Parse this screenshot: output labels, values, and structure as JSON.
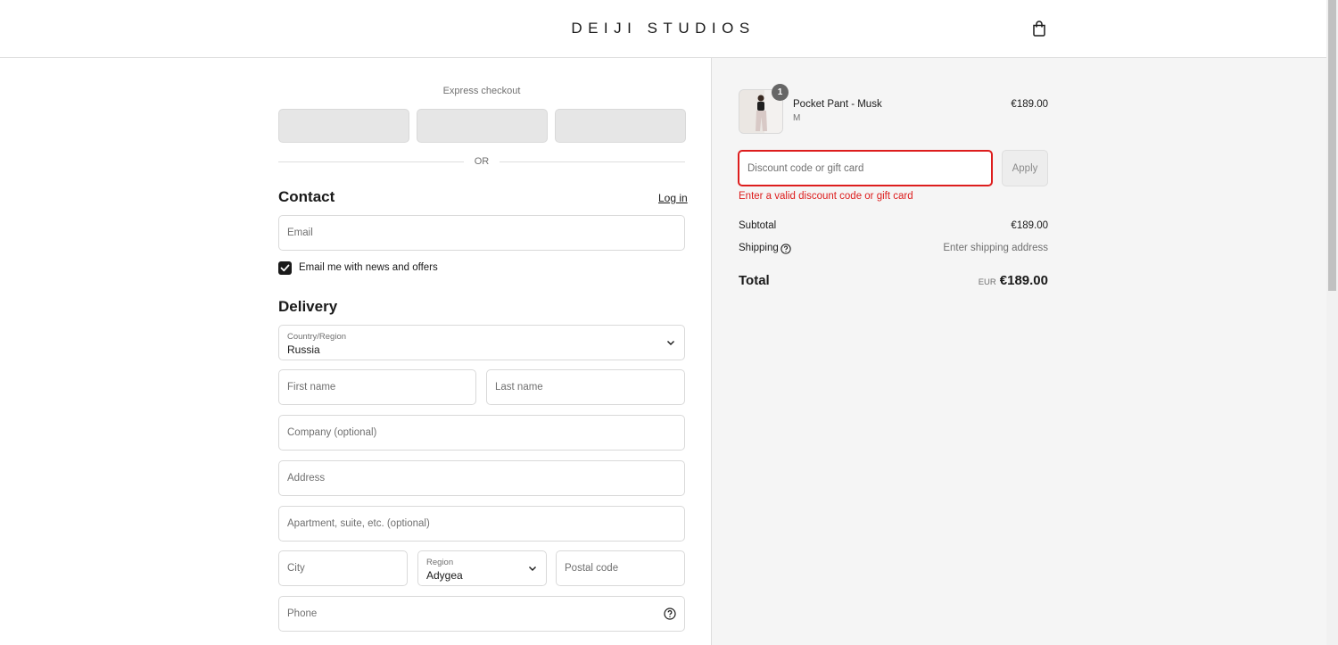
{
  "header": {
    "brand": "DEIJI STUDIOS",
    "cart_icon": "shopping-bag-icon"
  },
  "express": {
    "label": "Express checkout",
    "or_text": "OR"
  },
  "contact": {
    "title": "Contact",
    "login_link": "Log in",
    "email_placeholder": "Email",
    "newsletter_label": "Email me with news and offers",
    "newsletter_checked": true
  },
  "delivery": {
    "title": "Delivery",
    "country_label": "Country/Region",
    "country_value": "Russia",
    "first_name_placeholder": "First name",
    "last_name_placeholder": "Last name",
    "company_placeholder": "Company (optional)",
    "address_placeholder": "Address",
    "apartment_placeholder": "Apartment, suite, etc. (optional)",
    "city_placeholder": "City",
    "region_label": "Region",
    "region_value": "Adygea",
    "postal_placeholder": "Postal code",
    "phone_placeholder": "Phone"
  },
  "order": {
    "item": {
      "name": "Pocket Pant - Musk",
      "variant": "M",
      "price": "€189.00",
      "quantity": "1"
    },
    "discount_placeholder": "Discount code or gift card",
    "apply_label": "Apply",
    "error": "Enter a valid discount code or gift card",
    "subtotal_label": "Subtotal",
    "subtotal_value": "€189.00",
    "shipping_label": "Shipping",
    "shipping_value": "Enter shipping address",
    "total_label": "Total",
    "total_currency": "EUR",
    "total_value": "€189.00"
  },
  "colors": {
    "error": "#dd1d1d",
    "sidebar_bg": "#f5f5f5",
    "text": "#1a1a1a"
  }
}
